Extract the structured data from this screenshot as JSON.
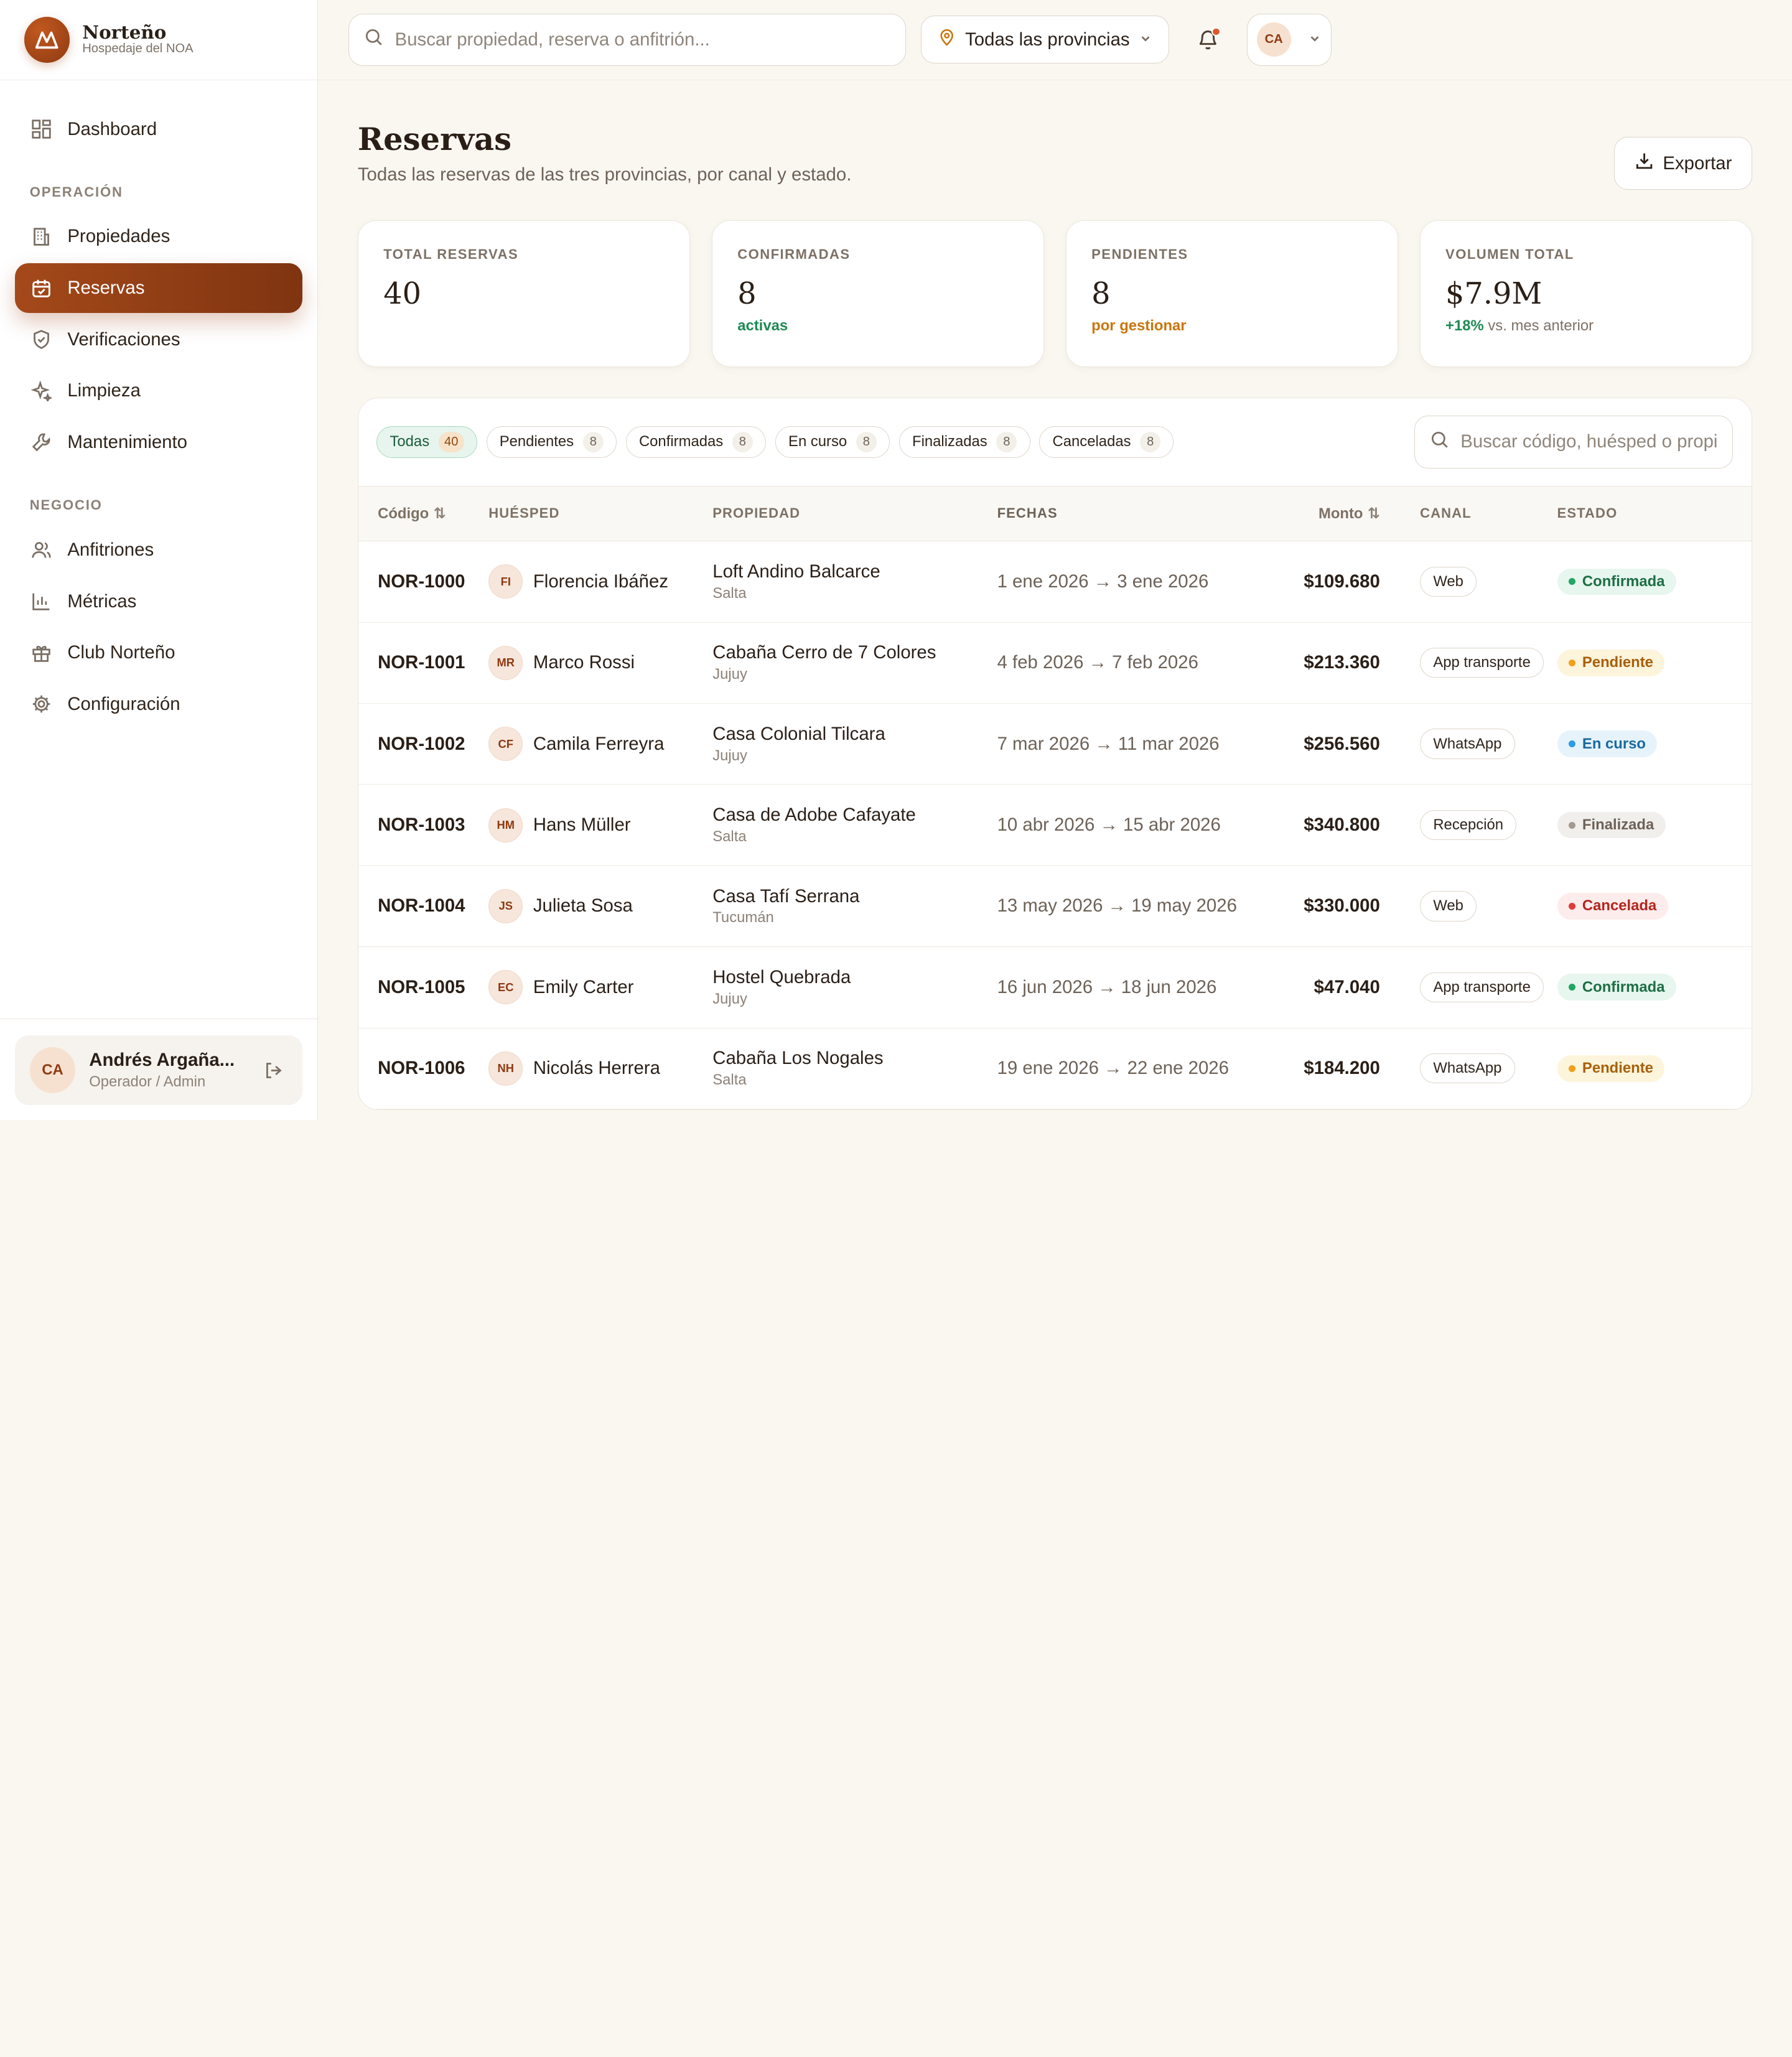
{
  "brand": {
    "name": "Norteño",
    "subtitle": "Hospedaje del NOA"
  },
  "sidebar": {
    "top_item": {
      "label": "Dashboard",
      "icon": "grid-icon"
    },
    "sections": [
      {
        "title": "OPERACIÓN",
        "items": [
          {
            "label": "Propiedades",
            "icon": "building-icon"
          },
          {
            "label": "Reservas",
            "icon": "calendar-icon",
            "active": true
          },
          {
            "label": "Verificaciones",
            "icon": "shield-check-icon"
          },
          {
            "label": "Limpieza",
            "icon": "sparkles-icon"
          },
          {
            "label": "Mantenimiento",
            "icon": "wrench-icon"
          }
        ]
      },
      {
        "title": "NEGOCIO",
        "items": [
          {
            "label": "Anfitriones",
            "icon": "users-icon"
          },
          {
            "label": "Métricas",
            "icon": "bar-chart-icon"
          },
          {
            "label": "Club Norteño",
            "icon": "gift-icon"
          },
          {
            "label": "Configuración",
            "icon": "gear-icon"
          }
        ]
      }
    ],
    "user": {
      "initials": "CA",
      "name": "Andrés Argaña...",
      "role": "Operador / Admin"
    }
  },
  "topbar": {
    "search_placeholder": "Buscar propiedad, reserva o anfitrión...",
    "province_label": "Todas las provincias",
    "user_initials": "CA"
  },
  "page": {
    "title": "Reservas",
    "subtitle": "Todas las reservas de las tres provincias, por canal y estado.",
    "export_label": "Exportar"
  },
  "stats": [
    {
      "label": "TOTAL RESERVAS",
      "value": "40",
      "note": "",
      "note_prefix": ""
    },
    {
      "label": "CONFIRMADAS",
      "value": "8",
      "note": "activas",
      "note_prefix": ""
    },
    {
      "label": "PENDIENTES",
      "value": "8",
      "note": "por gestionar",
      "note_prefix": ""
    },
    {
      "label": "VOLUMEN TOTAL",
      "value": "$7.9M",
      "note_prefix": "+18%",
      "note": "vs. mes anterior"
    }
  ],
  "filters": {
    "chips": [
      {
        "label": "Todas",
        "count": "40",
        "active": true
      },
      {
        "label": "Pendientes",
        "count": "8"
      },
      {
        "label": "Confirmadas",
        "count": "8"
      },
      {
        "label": "En curso",
        "count": "8"
      },
      {
        "label": "Finalizadas",
        "count": "8"
      },
      {
        "label": "Canceladas",
        "count": "8"
      }
    ],
    "search_placeholder": "Buscar código, huésped o propiedad..."
  },
  "table": {
    "headers": {
      "code": "Código",
      "guest": "HUÉSPED",
      "property": "PROPIEDAD",
      "dates": "FECHAS",
      "amount": "Monto",
      "channel": "CANAL",
      "state": "ESTADO"
    },
    "rows": [
      {
        "code": "NOR-1000",
        "initials": "FI",
        "guest": "Florencia Ibáñez",
        "property": "Loft Andino Balcarce",
        "province": "Salta",
        "dates": "1 ene 2026 → 3 ene 2026",
        "amount": "$109.680",
        "channel": "Web",
        "state": "Confirmada",
        "state_color": "green"
      },
      {
        "code": "NOR-1001",
        "initials": "MR",
        "guest": "Marco Rossi",
        "property": "Cabaña Cerro de 7 Colores",
        "province": "Jujuy",
        "dates": "4 feb 2026 → 7 feb 2026",
        "amount": "$213.360",
        "channel": "App transporte",
        "state": "Pendiente",
        "state_color": "yellow"
      },
      {
        "code": "NOR-1002",
        "initials": "CF",
        "guest": "Camila Ferreyra",
        "property": "Casa Colonial Tilcara",
        "province": "Jujuy",
        "dates": "7 mar 2026 → 11 mar 2026",
        "amount": "$256.560",
        "channel": "WhatsApp",
        "state": "En curso",
        "state_color": "blue"
      },
      {
        "code": "NOR-1003",
        "initials": "HM",
        "guest": "Hans Müller",
        "property": "Casa de Adobe Cafayate",
        "province": "Salta",
        "dates": "10 abr 2026 → 15 abr 2026",
        "amount": "$340.800",
        "channel": "Recepción",
        "state": "Finalizada",
        "state_color": "gray"
      },
      {
        "code": "NOR-1004",
        "initials": "JS",
        "guest": "Julieta Sosa",
        "property": "Casa Tafí Serrana",
        "province": "Tucumán",
        "dates": "13 may 2026 → 19 may 2026",
        "amount": "$330.000",
        "channel": "Web",
        "state": "Cancelada",
        "state_color": "red"
      },
      {
        "code": "NOR-1005",
        "initials": "EC",
        "guest": "Emily Carter",
        "property": "Hostel Quebrada",
        "province": "Jujuy",
        "dates": "16 jun 2026 → 18 jun 2026",
        "amount": "$47.040",
        "channel": "App transporte",
        "state": "Confirmada",
        "state_color": "green"
      },
      {
        "code": "NOR-1006",
        "initials": "NH",
        "guest": "Nicolás Herrera",
        "property": "Cabaña Los Nogales",
        "province": "Salta",
        "dates": "19 ene 2026 → 22 ene 2026",
        "amount": "$184.200",
        "channel": "WhatsApp",
        "state": "Pendiente",
        "state_color": "yellow"
      }
    ]
  },
  "colors": {
    "accent": "#a4491a",
    "background": "#faf7f1",
    "success": "#1f8a55",
    "warning": "#c9760d"
  }
}
